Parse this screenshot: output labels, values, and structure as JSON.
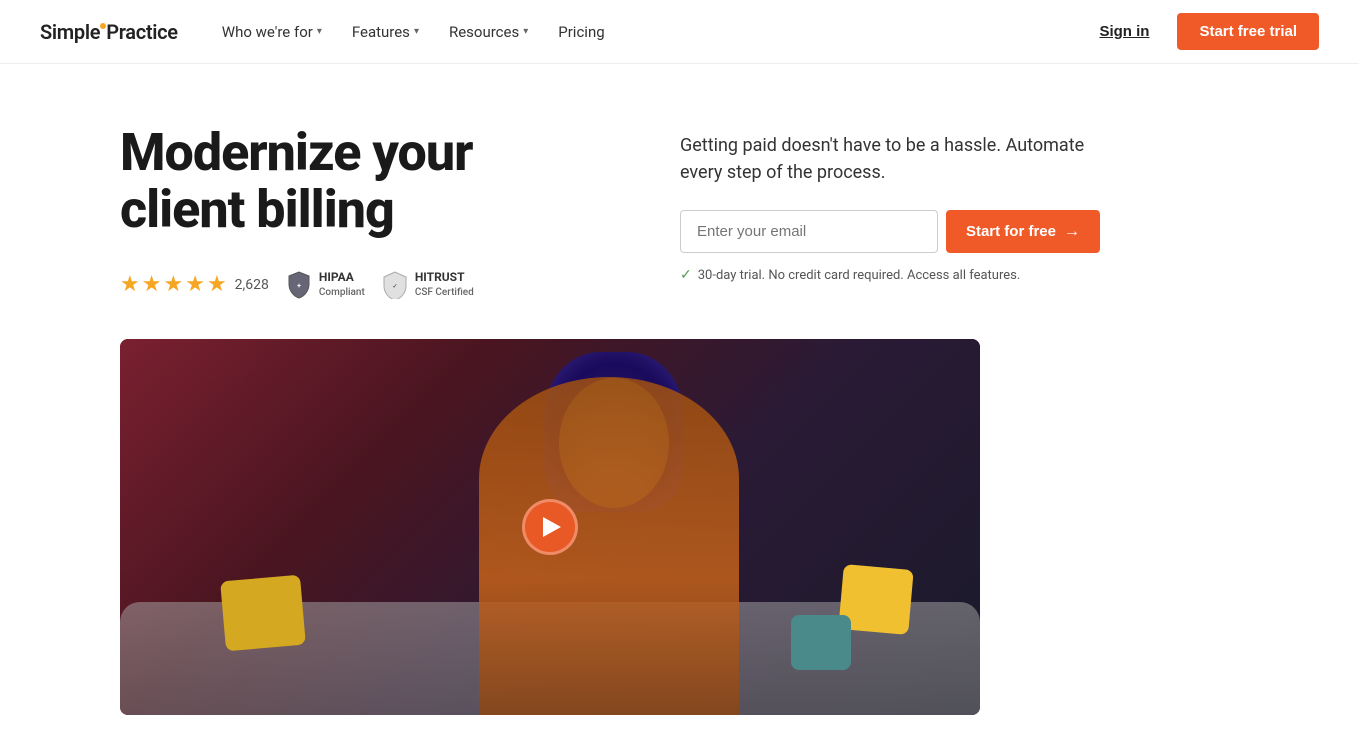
{
  "brand": {
    "name_simple": "Simple",
    "name_practice": "Practice"
  },
  "nav": {
    "who_label": "Who we're for",
    "features_label": "Features",
    "resources_label": "Resources",
    "pricing_label": "Pricing",
    "sign_in_label": "Sign in",
    "start_trial_label": "Start free trial"
  },
  "hero": {
    "title": "Modernize your client billing",
    "review_count": "2,628",
    "hipaa_label": "HIPAA",
    "hipaa_sub": "Compliant",
    "hitrust_label": "HITRUST",
    "hitrust_sub": "CSF Certified",
    "subtitle": "Getting paid doesn't have to be a hassle. Automate every step of the process.",
    "email_placeholder": "Enter your email",
    "cta_label": "Start for free",
    "trial_note": "30-day trial. No credit card required. Access all features."
  },
  "video": {
    "play_label": "Play video"
  },
  "colors": {
    "accent": "#f05a28",
    "star": "#f5a623"
  }
}
